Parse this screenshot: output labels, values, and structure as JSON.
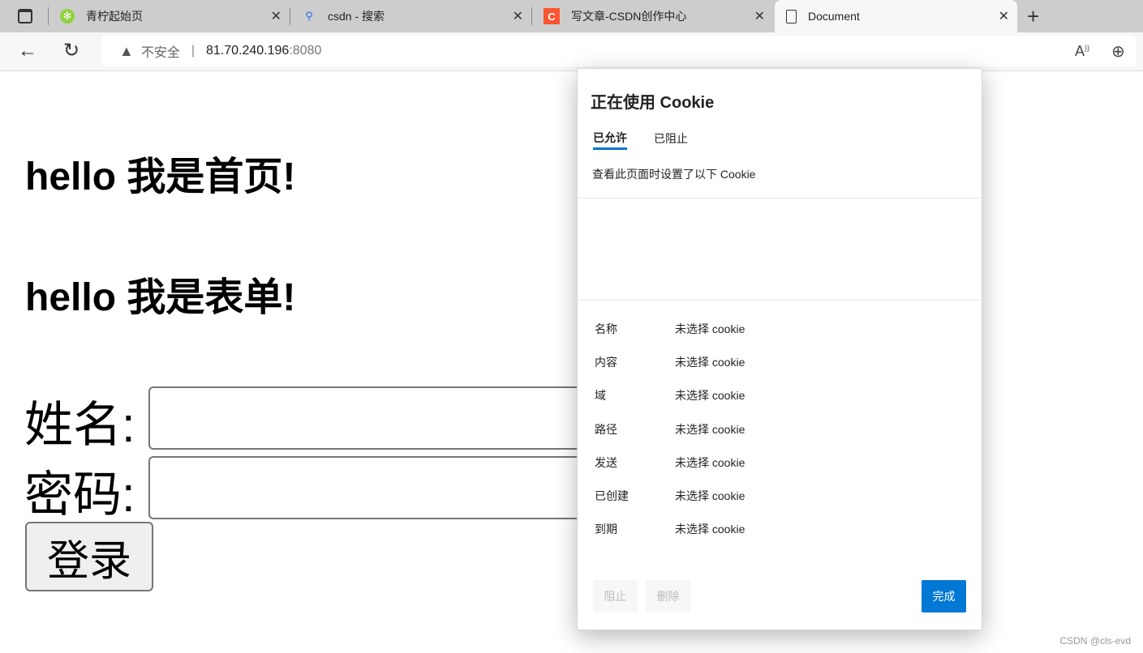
{
  "tabs": [
    {
      "title": "青柠起始页",
      "icon": "lime-icon"
    },
    {
      "title": "csdn - 搜索",
      "icon": "search-icon"
    },
    {
      "title": "写文章-CSDN创作中心",
      "icon": "csdn-icon"
    },
    {
      "title": "Document",
      "icon": "document-icon"
    }
  ],
  "address": {
    "warning": "不安全",
    "host": "81.70.240.196",
    "port": ":8080"
  },
  "page": {
    "heading1": "hello 我是首页!",
    "heading2": "hello 我是表单!",
    "name_label": "姓名:",
    "password_label": "密码:",
    "login_button": "登录"
  },
  "cookie_popup": {
    "title": "正在使用 Cookie",
    "tabs": [
      "已允许",
      "已阻止"
    ],
    "description": "查看此页面时设置了以下 Cookie",
    "fields": [
      {
        "label": "名称",
        "value": "未选择 cookie"
      },
      {
        "label": "内容",
        "value": "未选择 cookie"
      },
      {
        "label": "域",
        "value": "未选择 cookie"
      },
      {
        "label": "路径",
        "value": "未选择 cookie"
      },
      {
        "label": "发送",
        "value": "未选择 cookie"
      },
      {
        "label": "已创建",
        "value": "未选择 cookie"
      },
      {
        "label": "到期",
        "value": "未选择 cookie"
      }
    ],
    "block_button": "阻止",
    "delete_button": "删除",
    "done_button": "完成"
  },
  "watermark": "CSDN @cls-evd",
  "colors": {
    "accent": "#0078d4"
  }
}
